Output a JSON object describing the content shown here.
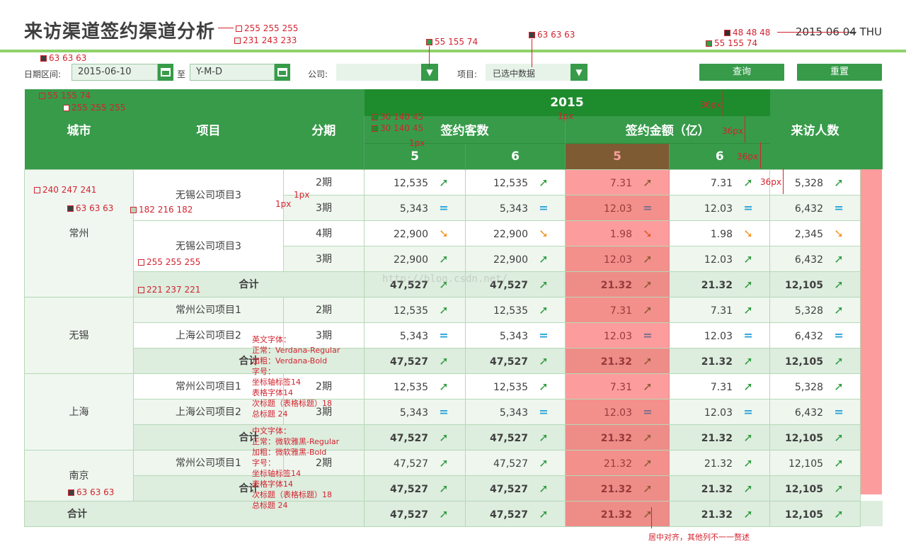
{
  "header": {
    "title": "来访渠道签约渠道分析",
    "date_struck": "2015 06 04",
    "weekday": "THU"
  },
  "filters": {
    "date_label": "日期区间:",
    "date_from": "2015-06-10",
    "to_label": "至",
    "date_to_placeholder": "Y-M-D",
    "company_label": "公司:",
    "company_value": "",
    "project_label": "项目:",
    "project_value": "已选中数据",
    "query_label": "查询",
    "reset_label": "重置"
  },
  "table": {
    "headers": {
      "city": "城市",
      "project": "项目",
      "phase": "分期",
      "year": "2015",
      "signed_customers": "签约客数",
      "signed_amount": "签约金额（亿）",
      "visitors": "来访人数",
      "month_a": "5",
      "month_b": "6",
      "month_c": "5",
      "month_d": "6"
    },
    "rows": [
      {
        "city": "常州",
        "project": "无锡公司项目3",
        "phase": "2期",
        "c5": "12,535",
        "c5t": "up",
        "c6": "12,535",
        "c6t": "up",
        "a5": "7.31",
        "a5t": "up",
        "a6": "7.31",
        "a6t": "up",
        "v": "5,328",
        "vt": "up"
      },
      {
        "city": "",
        "project": "",
        "phase": "3期",
        "c5": "5,343",
        "c5t": "eq",
        "c6": "5,343",
        "c6t": "eq",
        "a5": "12.03",
        "a5t": "eq",
        "a6": "12.03",
        "a6t": "eq",
        "v": "6,432",
        "vt": "eq"
      },
      {
        "city": "",
        "project": "无锡公司项目3",
        "phase": "4期",
        "c5": "22,900",
        "c5t": "down",
        "c6": "22,900",
        "c6t": "down",
        "a5": "1.98",
        "a5t": "down",
        "a6": "1.98",
        "a6t": "down",
        "v": "2,345",
        "vt": "down"
      },
      {
        "city": "",
        "project": "",
        "phase": "3期",
        "c5": "22,900",
        "c5t": "up",
        "c6": "22,900",
        "c6t": "up",
        "a5": "12.03",
        "a5t": "up",
        "a6": "12.03",
        "a6t": "up",
        "v": "6,432",
        "vt": "up"
      },
      {
        "city": "",
        "project": "合计",
        "phase": "",
        "c5": "47,527",
        "c5t": "up",
        "c6": "47,527",
        "c6t": "up",
        "a5": "21.32",
        "a5t": "up",
        "a6": "21.32",
        "a6t": "up",
        "v": "12,105",
        "vt": "up"
      },
      {
        "city": "无锡",
        "project": "常州公司项目1",
        "phase": "2期",
        "c5": "12,535",
        "c5t": "up",
        "c6": "12,535",
        "c6t": "up",
        "a5": "7.31",
        "a5t": "up",
        "a6": "7.31",
        "a6t": "up",
        "v": "5,328",
        "vt": "up"
      },
      {
        "city": "",
        "project": "上海公司项目2",
        "phase": "3期",
        "c5": "5,343",
        "c5t": "eq",
        "c6": "5,343",
        "c6t": "eq",
        "a5": "12.03",
        "a5t": "eq",
        "a6": "12.03",
        "a6t": "eq",
        "v": "6,432",
        "vt": "eq"
      },
      {
        "city": "",
        "project": "合计",
        "phase": "",
        "c5": "47,527",
        "c5t": "up",
        "c6": "47,527",
        "c6t": "up",
        "a5": "21.32",
        "a5t": "up",
        "a6": "21.32",
        "a6t": "up",
        "v": "12,105",
        "vt": "up"
      },
      {
        "city": "上海",
        "project": "常州公司项目1",
        "phase": "2期",
        "c5": "12,535",
        "c5t": "up",
        "c6": "12,535",
        "c6t": "up",
        "a5": "7.31",
        "a5t": "up",
        "a6": "7.31",
        "a6t": "up",
        "v": "5,328",
        "vt": "up"
      },
      {
        "city": "",
        "project": "上海公司项目2",
        "phase": "3期",
        "c5": "5,343",
        "c5t": "eq",
        "c6": "5,343",
        "c6t": "eq",
        "a5": "12.03",
        "a5t": "eq",
        "a6": "12.03",
        "a6t": "eq",
        "v": "6,432",
        "vt": "eq"
      },
      {
        "city": "",
        "project": "合计",
        "phase": "",
        "c5": "47,527",
        "c5t": "up",
        "c6": "47,527",
        "c6t": "up",
        "a5": "21.32",
        "a5t": "up",
        "a6": "21.32",
        "a6t": "up",
        "v": "12,105",
        "vt": "up"
      },
      {
        "city": "南京",
        "project": "常州公司项目1",
        "phase": "2期",
        "c5": "47,527",
        "c5t": "up",
        "c6": "47,527",
        "c6t": "up",
        "a5": "21.32",
        "a5t": "up",
        "a6": "21.32",
        "a6t": "up",
        "v": "12,105",
        "vt": "up"
      },
      {
        "city": "",
        "project": "合计",
        "phase": "",
        "c5": "47,527",
        "c5t": "up",
        "c6": "47,527",
        "c6t": "up",
        "a5": "21.32",
        "a5t": "up",
        "a6": "21.32",
        "a6t": "up",
        "v": "12,105",
        "vt": "up"
      }
    ],
    "grand_total": {
      "label": "合计",
      "c5": "47,527",
      "c6": "47,527",
      "a5": "21.32",
      "a6": "21.32",
      "v": "12,105"
    }
  },
  "annotations": {
    "c_255": "255 255 255",
    "c_231": "231 243 233",
    "c_55a": "55 155 74",
    "c_63a": "63 63 63",
    "c_48": "48 48 48",
    "c_55b": "55 155 74",
    "c_63b": "63 63 63",
    "c_55c": "55 155 74",
    "c_255b": "255 255 255",
    "c_30a": "30 140 45",
    "c_30b": "30 140 45",
    "c_1px_a": "1px",
    "c_1px_b": "1px",
    "c_1px_c": "1px",
    "c_1px_d": "1px",
    "c_36a": "36px",
    "c_36b": "36px",
    "c_36c": "36px",
    "c_36d": "36px",
    "c_240": "240 247 241",
    "c_182": "182 216 182",
    "c_63c": "63 63 63",
    "c_255c": "255 255 255",
    "c_221": "221 237 221",
    "c_63d": "63 63 63",
    "note_en": "英文字体：\n正常：Verdana-Regular\n加粗：Verdana-Bold\n字号：\n坐标轴标签14\n表格字体14\n次标题（表格标题）18\n总标题 24",
    "note_cn": "中文字体：\n正常：微软雅黑-Regular\n加粗：微软雅黑-Bold\n字号：\n坐标轴标签14\n表格字体14\n次标题（表格标题）18\n总标题 24",
    "caption": "居中对齐，其他列不一一赘述",
    "watermark": "http://blog.csdn.net/"
  },
  "colors": {
    "primary_green": "#379b4a",
    "dark_green": "#1e8c2d",
    "highlight_brown": "#7e5b32",
    "highlight_pink": "#fd9c9c",
    "arrow_up": "#2e9b3e",
    "arrow_equal": "#29a2da",
    "arrow_down": "#f49624"
  }
}
